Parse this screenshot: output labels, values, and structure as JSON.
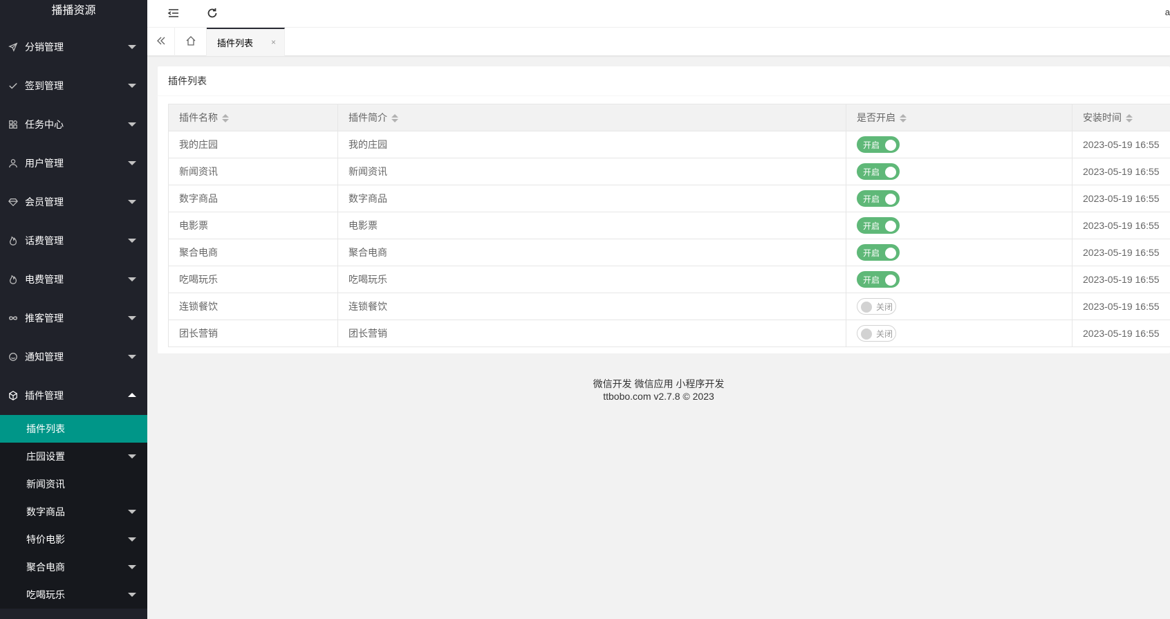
{
  "app": {
    "title": "播播资源"
  },
  "sidebar": {
    "items": [
      {
        "label": "分销管理",
        "icon": "send-icon"
      },
      {
        "label": "签到管理",
        "icon": "check-icon"
      },
      {
        "label": "任务中心",
        "icon": "apps-icon"
      },
      {
        "label": "用户管理",
        "icon": "user-icon"
      },
      {
        "label": "会员管理",
        "icon": "diamond-icon"
      },
      {
        "label": "话费管理",
        "icon": "fire-icon"
      },
      {
        "label": "电费管理",
        "icon": "fire-icon"
      },
      {
        "label": "推客管理",
        "icon": "infinity-icon"
      },
      {
        "label": "通知管理",
        "icon": "smile-icon"
      },
      {
        "label": "插件管理",
        "icon": "cube-icon"
      }
    ],
    "submenu": [
      {
        "label": "插件列表"
      },
      {
        "label": "庄园设置"
      },
      {
        "label": "新闻资讯"
      },
      {
        "label": "数字商品"
      },
      {
        "label": "特价电影"
      },
      {
        "label": "聚合电商"
      },
      {
        "label": "吃喝玩乐"
      }
    ]
  },
  "header": {
    "user": "a"
  },
  "tabs": {
    "active_label": "插件列表",
    "close": "×"
  },
  "card": {
    "title": "插件列表"
  },
  "table": {
    "columns": [
      "插件名称",
      "插件简介",
      "是否开启",
      "安装时间"
    ],
    "rows": [
      {
        "name": "我的庄园",
        "desc": "我的庄园",
        "switch": "开启",
        "time": "2023-05-19 16:55"
      },
      {
        "name": "新闻资讯",
        "desc": "新闻资讯",
        "switch": "开启",
        "time": "2023-05-19 16:55"
      },
      {
        "name": "数字商品",
        "desc": "数字商品",
        "switch": "开启",
        "time": "2023-05-19 16:55"
      },
      {
        "name": "电影票",
        "desc": "电影票",
        "switch": "开启",
        "time": "2023-05-19 16:55"
      },
      {
        "name": "聚合电商",
        "desc": "聚合电商",
        "switch": "开启",
        "time": "2023-05-19 16:55"
      },
      {
        "name": "吃喝玩乐",
        "desc": "吃喝玩乐",
        "switch": "开启",
        "time": "2023-05-19 16:55"
      },
      {
        "name": "连锁餐饮",
        "desc": "连锁餐饮",
        "switch": "关闭",
        "time": "2023-05-19 16:55"
      },
      {
        "name": "团长营销",
        "desc": "团长营销",
        "switch": "关闭",
        "time": "2023-05-19 16:55"
      }
    ]
  },
  "footer": {
    "links": "微信开发 微信应用 小程序开发",
    "copyright": "ttbobo.com v2.7.8 © 2023"
  },
  "colors": {
    "sidebar_bg": "#20222a",
    "active": "#009688",
    "switch_on": "#5fb878"
  }
}
